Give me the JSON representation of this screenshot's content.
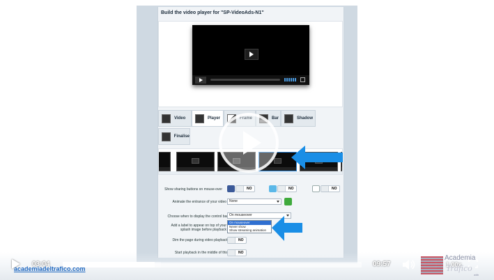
{
  "builder": {
    "title": "Build the video player for \"SP-VideoAds-N1\"",
    "tabs": [
      {
        "label": "Video",
        "active": false
      },
      {
        "label": "Player",
        "active": true
      },
      {
        "label": "Frame",
        "active": false
      },
      {
        "label": "Bar",
        "active": false
      },
      {
        "label": "Shadow",
        "active": false
      },
      {
        "label": "Finalise",
        "active": false
      }
    ],
    "settings": {
      "sharing_label": "Show sharing buttons on mouse-over",
      "sharing_toggles": [
        "NO",
        "NO",
        "NO"
      ],
      "entrance_label": "Animate the entrance of your video",
      "entrance_value": "None",
      "controlbar_label": "Choose when to display the control bar",
      "controlbar_value": "On mouseover",
      "controlbar_options": [
        "On mouseover",
        "Never show",
        "Show streaming animation"
      ],
      "controlbar_highlight_index": 0,
      "splash_label": "Add a label to appear on top of your splash image before playback",
      "dim_label": "Dim the page during video playback",
      "dim_toggle": "NO",
      "start_label": "Start playback in the middle of this",
      "start_toggle": "NO"
    }
  },
  "video_controls": {
    "current_time": "03:04",
    "total_time": "09:57",
    "progress_fraction": 0.308,
    "buffered_fraction": 0.02,
    "speed": "1.00x",
    "cc_label": "CC",
    "site_link": "academiadeltrafico.com"
  },
  "logo": {
    "line1": "Academia",
    "line2": "Tráfico",
    "line3": "with"
  },
  "colors": {
    "arrow_blue": "#1a8ee6",
    "link_blue": "#1e67c0",
    "panel_bg": "#f1f4f7",
    "green_button": "#3faa3c"
  },
  "icons": {
    "play": "play-icon",
    "volume": "volume-icon",
    "cc": "cc-icon",
    "fullscreen": "fullscreen-icon"
  }
}
